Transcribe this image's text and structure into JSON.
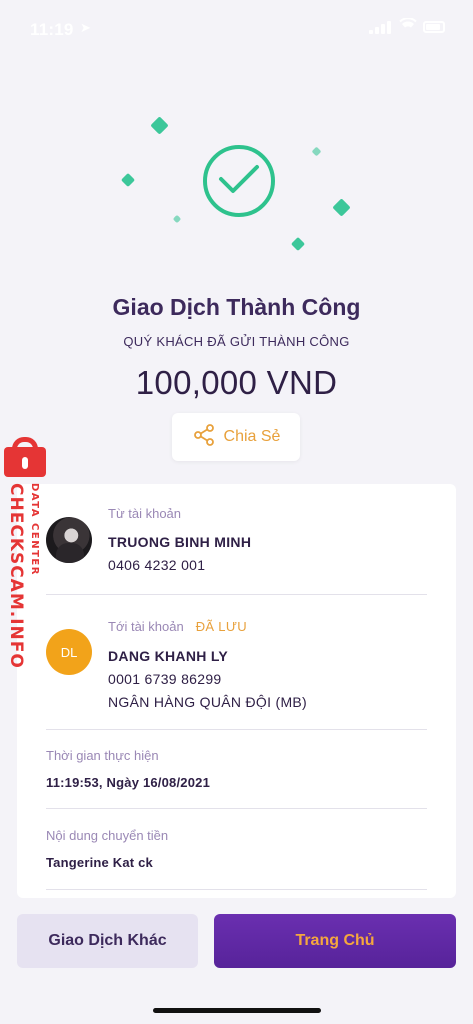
{
  "status_bar": {
    "time": "11:19",
    "arrow": "➤"
  },
  "hero": {
    "icon": "check-circle-icon",
    "accent": "#2ec28d"
  },
  "result": {
    "title": "Giao Dịch Thành Công",
    "subtitle": "QUÝ KHÁCH ĐÃ GỬI THÀNH CÔNG",
    "amount": "100,000 VND"
  },
  "share": {
    "label": "Chia Sẻ",
    "icon": "share-icon",
    "color": "#e8a13c"
  },
  "from_account": {
    "label": "Từ tài khoản",
    "name": "TRUONG BINH MINH",
    "number": "0406 4232 001"
  },
  "to_account": {
    "label": "Tới tài khoản",
    "saved_tag": "ĐÃ LƯU",
    "initials": "DL",
    "name": "DANG KHANH LY",
    "number": "0001 6739 86299",
    "bank": "NGÂN HÀNG QUÂN ĐỘI (MB)"
  },
  "time_info": {
    "label": "Thời gian thực hiện",
    "value": "11:19:53, Ngày 16/08/2021"
  },
  "content_info": {
    "label": "Nội dung chuyển tiền",
    "value": "Tangerine Kat ck"
  },
  "buttons": {
    "other": "Giao Dịch Khác",
    "home": "Trang Chủ"
  },
  "watermark": {
    "main": "CHECKSCAM.INFO",
    "sub": "DATA CENTER",
    "color": "#e53535"
  },
  "colors": {
    "primary": "#57239a",
    "accent": "#f5a73d",
    "success": "#2ec28d"
  }
}
